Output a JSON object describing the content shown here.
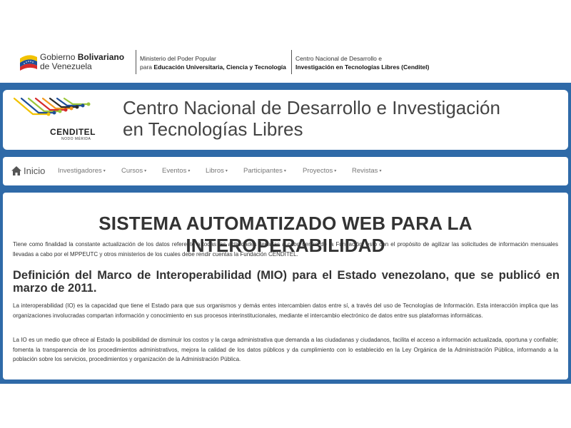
{
  "gov_header": {
    "gov_prefix": "Gobierno ",
    "gov_bold": "Bolivariano",
    "gov_line2": "de Venezuela",
    "ministry_line1": "Ministerio del Poder Popular",
    "ministry_line2_prefix": "para ",
    "ministry_line2_bold": "Educación Universitaria, Ciencia y Tecnología",
    "center_line1": "Centro Nacional de Desarrollo e",
    "center_line2": "Investigación en Tecnologías Libres (Cenditel)"
  },
  "banner": {
    "logo_text": "CENDITEL",
    "logo_subtext": "NODO MÉRIDA",
    "title_line1": "Centro Nacional de Desarrollo e Investigación",
    "title_line2": "en Tecnologías Libres"
  },
  "nav": {
    "home": "Inicio",
    "items": [
      {
        "label": "Investigadores"
      },
      {
        "label": "Cursos"
      },
      {
        "label": "Eventos"
      },
      {
        "label": "Libros"
      },
      {
        "label": "Participantes"
      },
      {
        "label": "Proyectos"
      },
      {
        "label": "Revistas"
      }
    ]
  },
  "main": {
    "title": "SISTEMA AUTOMATIZADO WEB PARA LA INTEROPERABILIDAD",
    "intro": "Tiene como finalidad la constante actualización de los datos referente a todas las actividades llevadas a cabo dentro de la Fundación, esto con el propósito de agilizar las solicitudes de información mensuales llevadas a cabo por el MPPEUTC y otros ministerios de los cuales debe rendir cuentas la Fundación CENDITEL.",
    "subheading": "Definición del Marco de Interoperabilidad (MIO) para el Estado venezolano, que se publicó en marzo de 2011.",
    "para1": "La interoperabilidad (IO) es la capacidad que tiene el Estado para que sus organismos y demás entes intercambien datos entre sí, a través del uso de Tecnologías de Información. Esta interacción implica que las organizaciones involucradas compartan información y conocimiento en sus procesos interinstitucionales, mediante el intercambio electrónico de datos entre sus plataformas informáticas.",
    "para2": "La IO es un medio que ofrece al Estado la posibilidad de disminuir los costos y la carga administrativa que demanda a las ciudadanas y ciudadanos, facilita el acceso a información actualizada, oportuna y confiable; fomenta la transparencia de los procedimientos administrativos, mejora la calidad de los datos públicos y da cumplimiento con lo establecido en la Ley Orgánica de la Administración Pública, informando a la población sobre los servicios, procedimientos y organización de la Administración Pública."
  },
  "colors": {
    "frame_blue": "#2f6aa8",
    "logo_yellow": "#f2c200",
    "logo_blue": "#1f4e99",
    "logo_red": "#d62b2b",
    "logo_orange": "#f39a1e",
    "logo_green": "#9cc63b"
  },
  "icons": {
    "home": "home-icon",
    "gov_flag": "venezuela-flag-icon"
  }
}
